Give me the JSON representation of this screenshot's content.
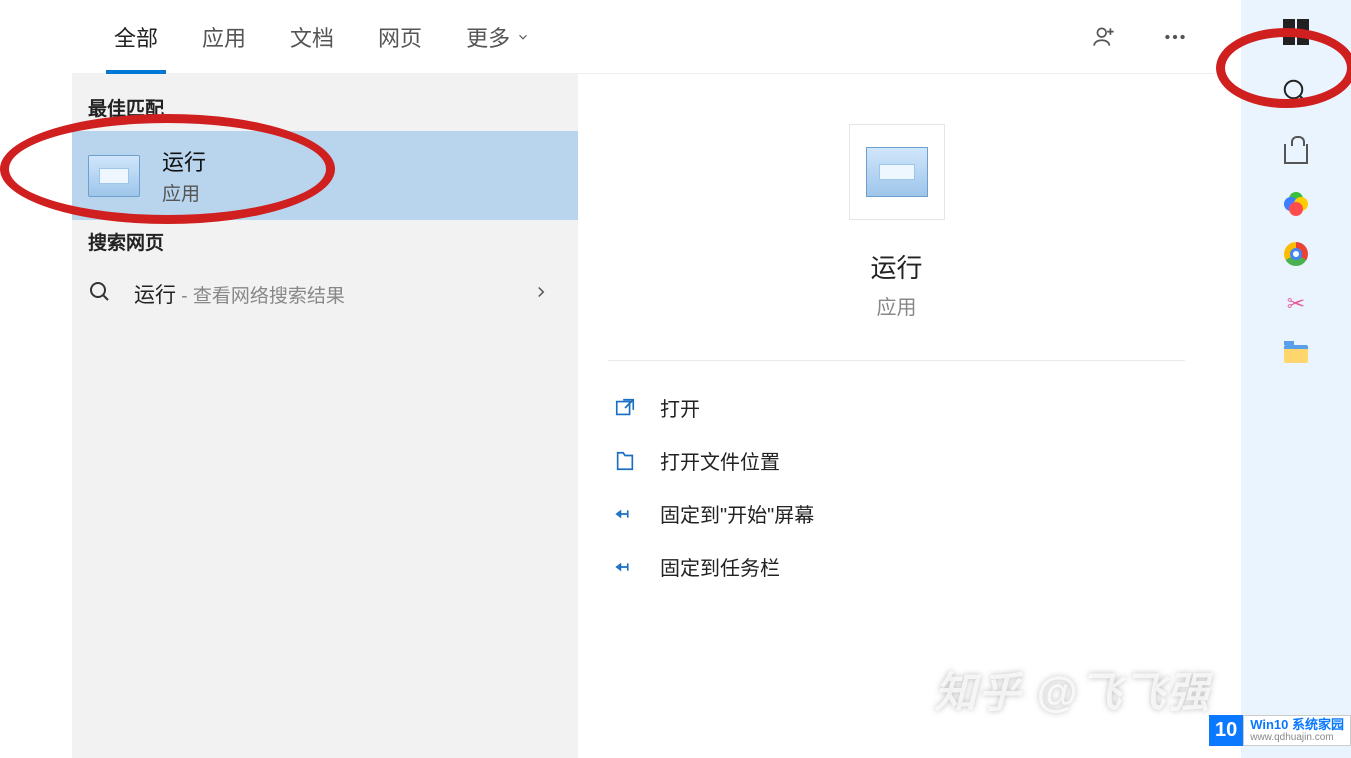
{
  "tabs": {
    "all": "全部",
    "apps": "应用",
    "docs": "文档",
    "web": "网页",
    "more": "更多"
  },
  "sections": {
    "best_match": "最佳匹配",
    "search_web": "搜索网页"
  },
  "best": {
    "title": "运行",
    "subtitle": "应用"
  },
  "webSearch": {
    "query": "运行",
    "hint": " - 查看网络搜索结果"
  },
  "preview": {
    "title": "运行",
    "subtitle": "应用"
  },
  "actions": {
    "open": "打开",
    "open_location": "打开文件位置",
    "pin_start": "固定到\"开始\"屏幕",
    "pin_taskbar": "固定到任务栏"
  },
  "watermark": "知乎 @飞飞强",
  "badge": {
    "logo": "10",
    "line1": "Win10 系统家园",
    "line2": "www.qdhuajin.com"
  }
}
